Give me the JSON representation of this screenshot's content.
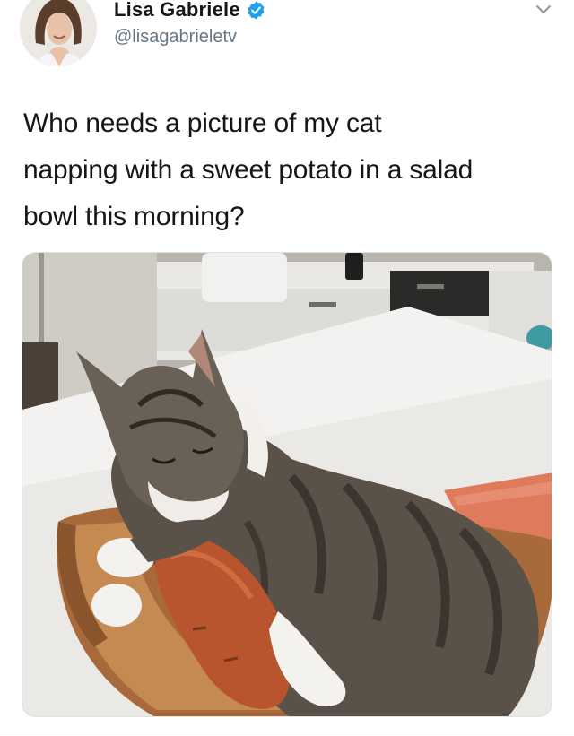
{
  "author": {
    "display_name": "Lisa Gabriele",
    "handle": "@lisagabrieletv",
    "verified": true,
    "avatar_icon": "profile-photo"
  },
  "tweet": {
    "text_lines": [
      "Who needs a picture of my cat",
      "napping with a sweet potato in a salad",
      "bowl this morning?"
    ],
    "media_icon": "cat-photo"
  },
  "icons": {
    "verified": "verified-badge-icon",
    "menu": "chevron-down-icon"
  },
  "colors": {
    "verified_blue": "#1da1f2",
    "handle_gray": "#657786",
    "text": "#14171a"
  }
}
